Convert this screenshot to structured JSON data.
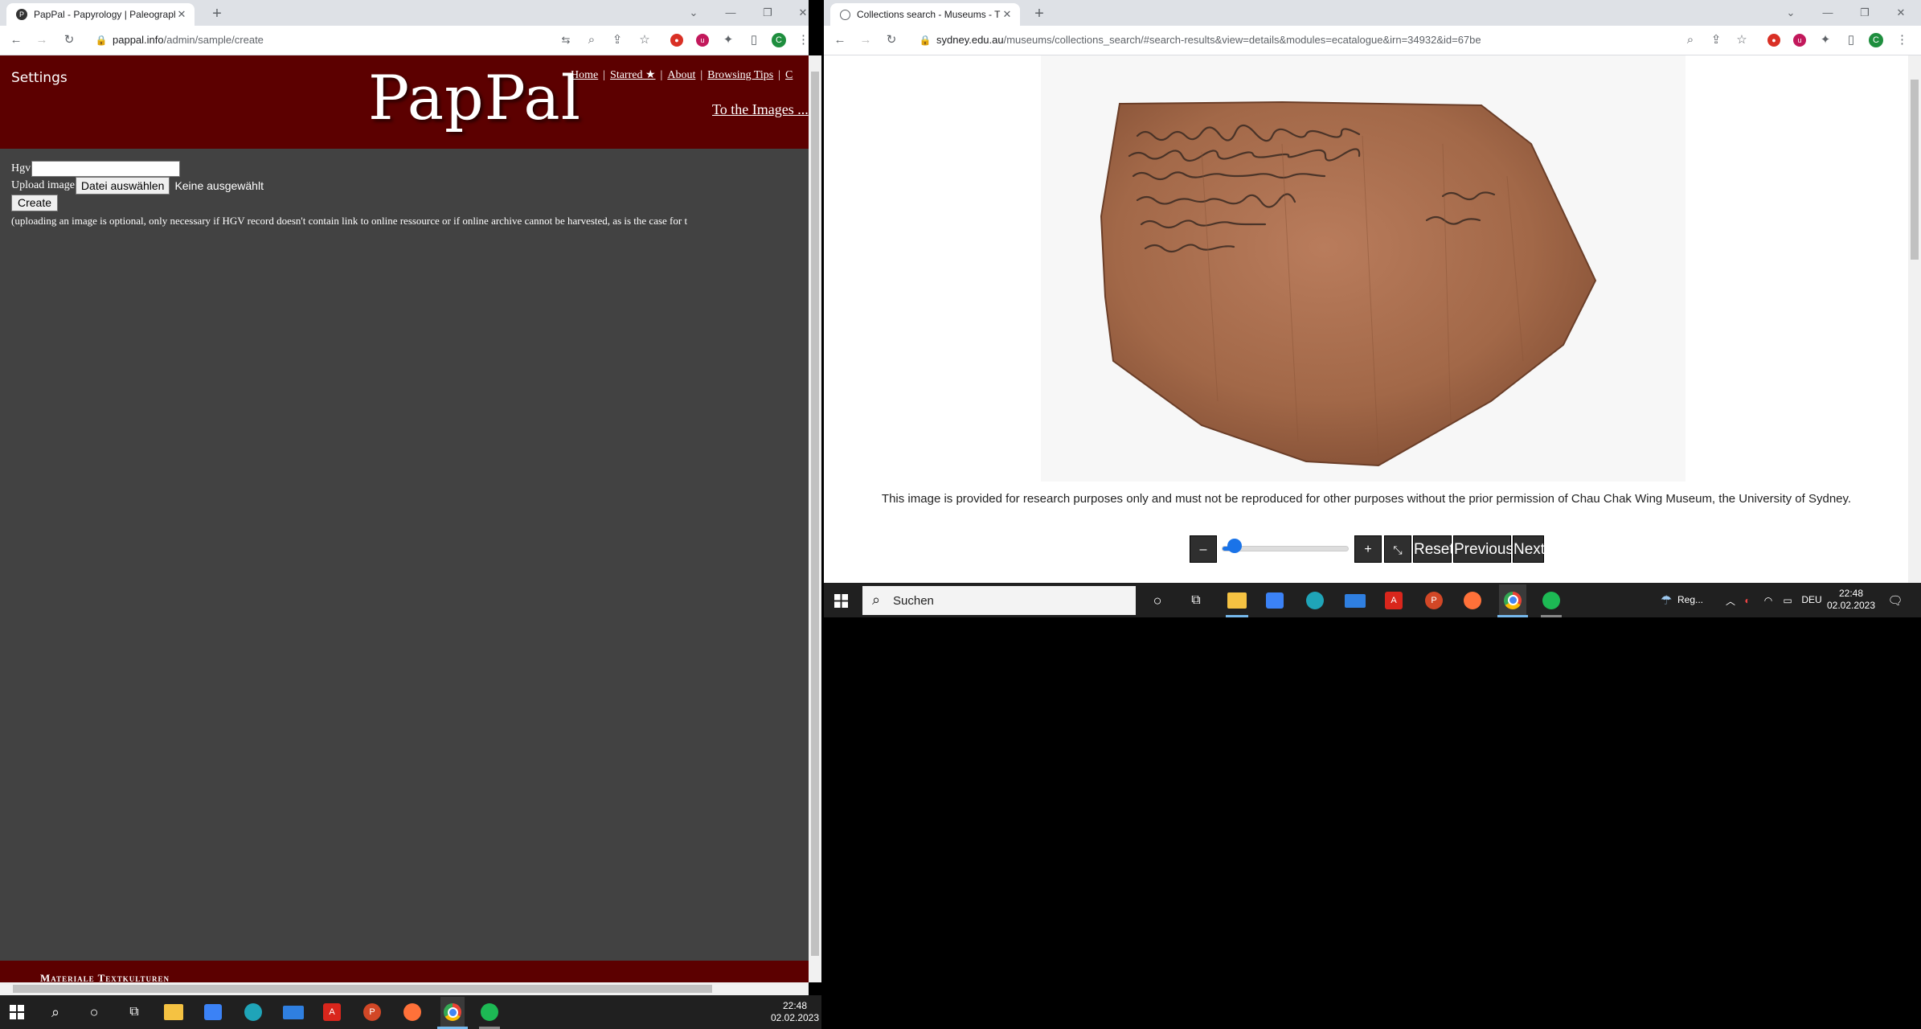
{
  "left_window": {
    "tab": {
      "title": "PapPal - Papyrology | Paleography",
      "favicon": "P"
    },
    "url": {
      "host": "pappal.info",
      "path": "/admin/sample/create"
    },
    "page": {
      "settings_label": "Settings",
      "logo": "PapPal",
      "nav": [
        "Home",
        "Starred ★",
        "About",
        "Browsing Tips"
      ],
      "to_images": "To the Images ...",
      "form": {
        "hgv_label": "Hgv",
        "hgv_value": "",
        "upload_label": "Upload image",
        "file_button": "Datei auswählen",
        "no_file": "Keine ausgewählt",
        "create_button": "Create",
        "note": "(uploading an image is optional, only necessary if HGV record doesn't contain link to online ressource or if online archive cannot be harvested, as is the case for t"
      },
      "footer_text": "Materiale Textkulturen"
    }
  },
  "right_window": {
    "tab": {
      "title": "Collections search - Museums - The"
    },
    "url": {
      "host": "sydney.edu.au",
      "path": "/museums/collections_search/#search-results&view=details&modules=ecatalogue&irn=34932&id=67be"
    },
    "page": {
      "image_alt": "ostracon with Greek writing",
      "caption": "This image is provided for research purposes only and must not be reproduced for other purposes without the prior permission of Chau Chak Wing Museum, the University of Sydney.",
      "controls": {
        "zoom_out": "–",
        "zoom_in": "+",
        "fit": "⤡",
        "reset": "Reset",
        "previous": "Previous",
        "next": "Next",
        "zoom_level": 0.1
      }
    }
  },
  "taskbar_right": {
    "search_placeholder": "Suchen",
    "weather": "Reg...",
    "language": "DEU",
    "time": "22:48",
    "date": "02.02.2023"
  },
  "taskbar_left": {
    "time": "22:48",
    "date": "02.02.2023"
  },
  "colors": {
    "pappal_header": "#5c0000",
    "pappal_body": "#424242",
    "chrome_tabstrip": "#dee1e6",
    "taskbar": "#202020",
    "accent": "#1a73e8"
  }
}
